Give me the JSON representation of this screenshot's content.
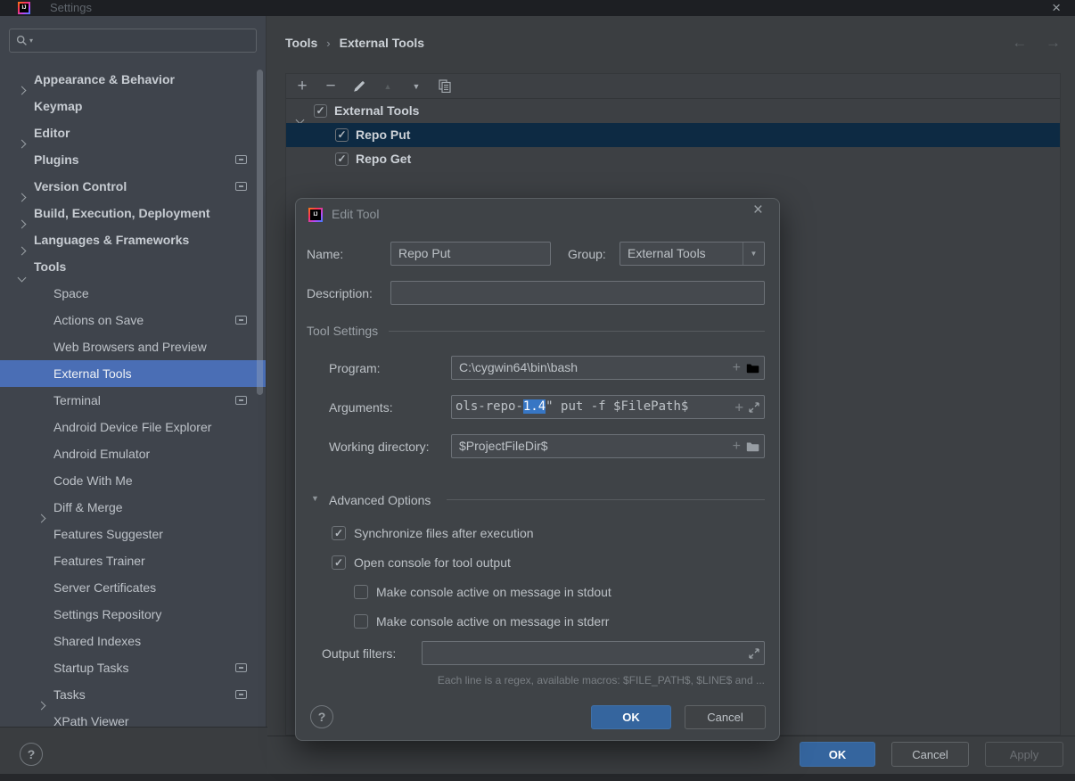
{
  "glyphs": {
    "check": "✓",
    "close": "×",
    "breadcrumb_sep": "›",
    "back": "←",
    "forward": "→",
    "plus": "+",
    "minus": "−",
    "up": "▲",
    "down": "▼",
    "search_caret": "▾",
    "help": "?",
    "logo": "IJ",
    "combo_down": "▼"
  },
  "window": {
    "title": "Settings"
  },
  "sidebar": {
    "items": [
      {
        "label": "Appearance & Behavior",
        "arrow": "right",
        "bold": true,
        "indent": 0,
        "config": false,
        "selected": false
      },
      {
        "label": "Keymap",
        "arrow": null,
        "bold": true,
        "indent": 0,
        "config": false,
        "selected": false
      },
      {
        "label": "Editor",
        "arrow": "right",
        "bold": true,
        "indent": 0,
        "config": false,
        "selected": false
      },
      {
        "label": "Plugins",
        "arrow": null,
        "bold": true,
        "indent": 0,
        "config": true,
        "selected": false
      },
      {
        "label": "Version Control",
        "arrow": "right",
        "bold": true,
        "indent": 0,
        "config": true,
        "selected": false
      },
      {
        "label": "Build, Execution, Deployment",
        "arrow": "right",
        "bold": true,
        "indent": 0,
        "config": false,
        "selected": false
      },
      {
        "label": "Languages & Frameworks",
        "arrow": "right",
        "bold": true,
        "indent": 0,
        "config": false,
        "selected": false
      },
      {
        "label": "Tools",
        "arrow": "down",
        "bold": true,
        "indent": 0,
        "config": false,
        "selected": false
      },
      {
        "label": "Space",
        "arrow": null,
        "bold": false,
        "indent": 1,
        "config": false,
        "selected": false
      },
      {
        "label": "Actions on Save",
        "arrow": null,
        "bold": false,
        "indent": 1,
        "config": true,
        "selected": false
      },
      {
        "label": "Web Browsers and Preview",
        "arrow": null,
        "bold": false,
        "indent": 1,
        "config": false,
        "selected": false
      },
      {
        "label": "External Tools",
        "arrow": null,
        "bold": false,
        "indent": 1,
        "config": false,
        "selected": true
      },
      {
        "label": "Terminal",
        "arrow": null,
        "bold": false,
        "indent": 1,
        "config": true,
        "selected": false
      },
      {
        "label": "Android Device File Explorer",
        "arrow": null,
        "bold": false,
        "indent": 1,
        "config": false,
        "selected": false
      },
      {
        "label": "Android Emulator",
        "arrow": null,
        "bold": false,
        "indent": 1,
        "config": false,
        "selected": false
      },
      {
        "label": "Code With Me",
        "arrow": null,
        "bold": false,
        "indent": 1,
        "config": false,
        "selected": false
      },
      {
        "label": "Diff & Merge",
        "arrow": "right",
        "bold": false,
        "indent": 1,
        "config": false,
        "selected": false
      },
      {
        "label": "Features Suggester",
        "arrow": null,
        "bold": false,
        "indent": 1,
        "config": false,
        "selected": false
      },
      {
        "label": "Features Trainer",
        "arrow": null,
        "bold": false,
        "indent": 1,
        "config": false,
        "selected": false
      },
      {
        "label": "Server Certificates",
        "arrow": null,
        "bold": false,
        "indent": 1,
        "config": false,
        "selected": false
      },
      {
        "label": "Settings Repository",
        "arrow": null,
        "bold": false,
        "indent": 1,
        "config": false,
        "selected": false
      },
      {
        "label": "Shared Indexes",
        "arrow": null,
        "bold": false,
        "indent": 1,
        "config": false,
        "selected": false
      },
      {
        "label": "Startup Tasks",
        "arrow": null,
        "bold": false,
        "indent": 1,
        "config": true,
        "selected": false
      },
      {
        "label": "Tasks",
        "arrow": "right",
        "bold": false,
        "indent": 1,
        "config": true,
        "selected": false
      },
      {
        "label": "XPath Viewer",
        "arrow": null,
        "bold": false,
        "indent": 1,
        "config": false,
        "selected": false
      }
    ]
  },
  "breadcrumb": {
    "first": "Tools",
    "second": "External Tools"
  },
  "toolbar": {
    "icons": [
      "add",
      "remove",
      "edit",
      "move-up",
      "move-down",
      "copy"
    ]
  },
  "tree": {
    "root": {
      "label": "External Tools",
      "checked": true
    },
    "children": [
      {
        "label": "Repo Put",
        "checked": true,
        "selected": true
      },
      {
        "label": "Repo Get",
        "checked": true,
        "selected": false
      }
    ]
  },
  "dialog": {
    "title": "Edit Tool",
    "name_label": "Name:",
    "name_value": "Repo Put",
    "group_label": "Group:",
    "group_value": "External Tools",
    "description_label": "Description:",
    "description_value": "",
    "section_tool_settings": "Tool Settings",
    "program_label": "Program:",
    "program_value": "C:\\cygwin64\\bin\\bash",
    "arguments_label": "Arguments:",
    "arguments_pre": "ols-repo-",
    "arguments_selection": "1.4",
    "arguments_post": "\" put -f $FilePath$",
    "workdir_label": "Working directory:",
    "workdir_value": "$ProjectFileDir$",
    "advanced_label": "Advanced Options",
    "checkboxes": [
      {
        "label": "Synchronize files after execution",
        "checked": true,
        "indent": 0
      },
      {
        "label": "Open console for tool output",
        "checked": true,
        "indent": 0
      },
      {
        "label": "Make console active on message in stdout",
        "checked": false,
        "indent": 1
      },
      {
        "label": "Make console active on message in stderr",
        "checked": false,
        "indent": 1
      }
    ],
    "output_label": "Output filters:",
    "output_value": "",
    "helper_text": "Each line is a regex, available macros: $FILE_PATH$, $LINE$ and ...",
    "ok": "OK",
    "cancel": "Cancel",
    "help": "?"
  },
  "footer": {
    "ok": "OK",
    "cancel": "Cancel",
    "apply": "Apply",
    "help": "?"
  }
}
